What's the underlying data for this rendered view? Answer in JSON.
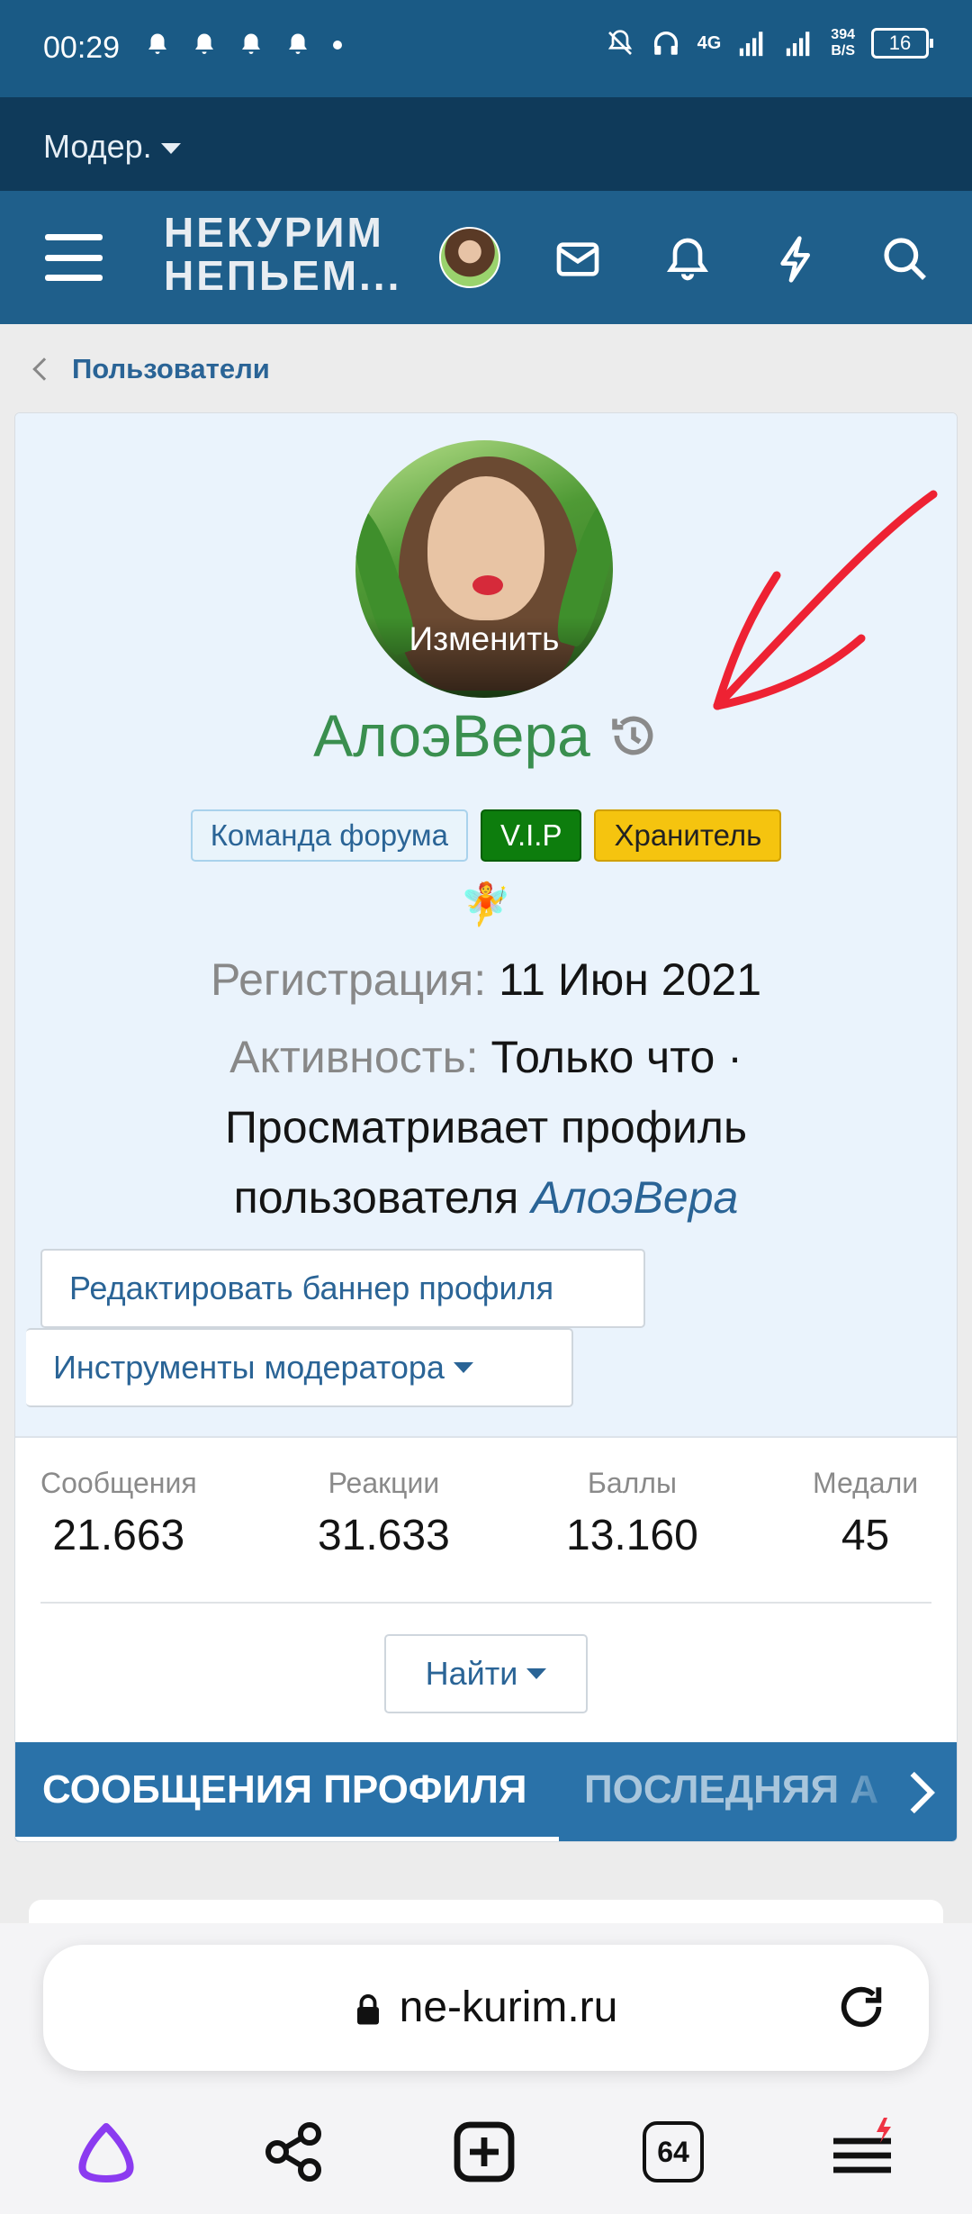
{
  "status_bar": {
    "time": "00:29",
    "network": "4G",
    "speed_value": "394",
    "speed_unit": "B/S",
    "battery": "16"
  },
  "mod_bar": {
    "label": "Модер."
  },
  "header": {
    "logo_line1": "НЕКУРИМ",
    "logo_line2": "НЕПЬЕМ..."
  },
  "breadcrumb": {
    "label": "Пользователи"
  },
  "profile": {
    "avatar_edit_label": "Изменить",
    "username": "АлоэВера",
    "badges": [
      "Команда форума",
      "V.I.P",
      "Хранитель"
    ],
    "emoji": "🧚",
    "registration_label": "Регистрация:",
    "registration_value": "11 Июн 2021",
    "activity_label": "Активность:",
    "activity_value": "Только что ·",
    "activity_line2": "Просматривает профиль",
    "activity_line3_prefix": "пользователя",
    "activity_line3_link": "АлоэВера",
    "edit_banner_button": "Редактировать баннер профиля",
    "moderator_tools_button": "Инструменты модератора"
  },
  "stats": [
    {
      "label": "Сообщения",
      "value": "21.663"
    },
    {
      "label": "Реакции",
      "value": "31.633"
    },
    {
      "label": "Баллы",
      "value": "13.160"
    },
    {
      "label": "Медали",
      "value": "45"
    }
  ],
  "find_button": "Найти",
  "tabs": [
    "СООБЩЕНИЯ ПРОФИЛЯ",
    "ПОСЛЕДНЯЯ А"
  ],
  "browser": {
    "url": "ne-kurim.ru",
    "tabs_count": "64"
  },
  "colors": {
    "header": "#1f5f8b",
    "mod_bar": "#0f3a5a",
    "username": "#3a8f4f",
    "link": "#2a6496",
    "vip": "#0d7d0d",
    "keeper": "#f5c40f",
    "tab_bar": "#2a72a9",
    "annotation_arrow": "#ee2233"
  }
}
